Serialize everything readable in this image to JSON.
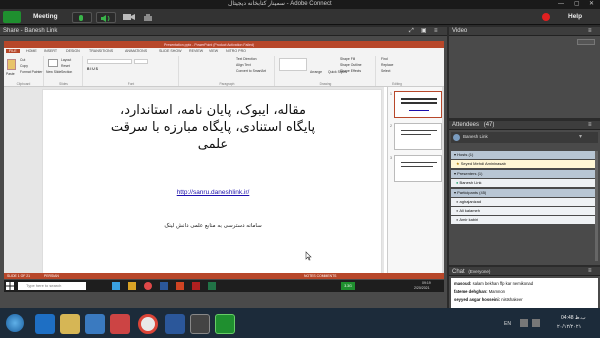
{
  "window": {
    "title_left": "Meeting",
    "title_center": "سمینار کتابخانه دیجیتال - Adobe Connect",
    "help": "Help"
  },
  "menu": {
    "meeting": "Meeting"
  },
  "share": {
    "header": "Share - Banesh Link",
    "ppt": {
      "window_title": "Presentation.pptx - PowerPoint (Product Activation Failed)",
      "tabs": [
        "FILE",
        "HOME",
        "INSERT",
        "DESIGN",
        "TRANSITIONS",
        "ANIMATIONS",
        "SLIDE SHOW",
        "REVIEW",
        "VIEW",
        "NITRO PRO"
      ],
      "groups": [
        "Clipboard",
        "Slides",
        "Font",
        "Paragraph",
        "Drawing",
        "Editing"
      ],
      "ribbon_items": {
        "cut": "Cut",
        "copy": "Copy",
        "paste": "Paste",
        "format_painter": "Format Painter",
        "new_slide": "New Slide",
        "layout": "Layout",
        "reset": "Reset",
        "section": "Section",
        "text_direction": "Text Direction",
        "align_text": "Align Text",
        "convert_smartart": "Convert to SmartArt",
        "arrange": "Arrange",
        "quick_styles": "Quick Styles",
        "shape_fill": "Shape Fill",
        "shape_outline": "Shape Outline",
        "shape_effects": "Shape Effects",
        "find": "Find",
        "replace": "Replace",
        "select": "Select"
      },
      "slide": {
        "title_line1": "مقاله، ایبوک، پایان نامه، استاندارد،",
        "title_line2": "پایگاه استنادی، پایگاه مبارزه با سرقت",
        "title_line3": "علمی",
        "link": "http://sanru.daneshlink.ir/",
        "subtitle": "سامانه دسترسی به منابع علمی دانش لینک"
      },
      "thumbs": [
        "1",
        "2",
        "3"
      ],
      "status_left": "SLIDE 1 OF 21",
      "status_lang": "PERSIAN",
      "status_right": "NOTES  COMMENTS"
    },
    "inner_taskbar": {
      "search_placeholder": "Type here to search",
      "time": "09:19",
      "date": "2/20/2021",
      "badge": "3.3G"
    }
  },
  "video": {
    "header": "Video"
  },
  "attendees": {
    "header": "Attendees",
    "count": "(47)",
    "host_self": "Banesh Link",
    "sections": [
      {
        "label": "Hosts (1)",
        "items": [
          "Seyed Mehdi Amininasab"
        ]
      },
      {
        "label": "Presenters (1)",
        "items": [
          "Banesh Link"
        ]
      },
      {
        "label": "Participants (45)",
        "items": [
          "aghajanizad",
          "Ali kalameh",
          "Amir kabiri"
        ]
      }
    ]
  },
  "chat": {
    "header": "Chat",
    "scope": "(Everyone)",
    "messages": [
      {
        "name": "masoud:",
        "text": "salam bekhan ffp kar nemikonad"
      },
      {
        "name": "fateme dehghan:",
        "text": "Mamnon"
      },
      {
        "name": "seyyed asgar hosseini:",
        "text": "nistshakeer"
      }
    ],
    "recipient": "Everyone"
  },
  "taskbar": {
    "lang": "EN",
    "time": "04:48 ب.ظ",
    "date": "۲۰/۱۲/۲۰۲۱"
  },
  "colors": {
    "ppt_accent": "#b7472a",
    "adobe_bg": "#4a4a4a",
    "taskbar": "#1c2b3a",
    "record": "#e02020"
  }
}
